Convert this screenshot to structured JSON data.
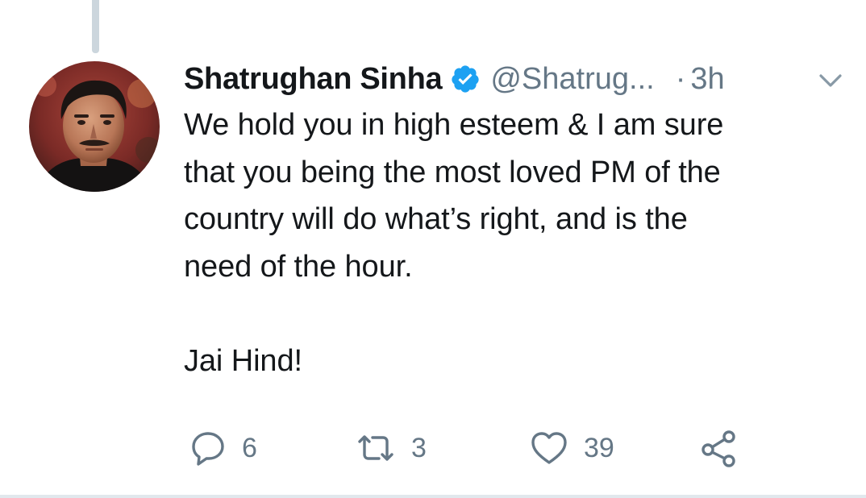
{
  "tweet": {
    "author": {
      "display_name": "Shatrughan Sinha",
      "handle": "@Shatrug...",
      "verified": true,
      "avatar_icon": "profile-photo"
    },
    "separator": "·",
    "time": "3h",
    "menu_icon": "chevron-down-icon",
    "text": "We hold you in high esteem & I am sure\nthat you being the most loved PM of the\ncountry will do what’s right, and is the\nneed of the hour.\n\nJai Hind!",
    "actions": {
      "reply": {
        "icon": "reply-icon",
        "count": "6"
      },
      "retweet": {
        "icon": "retweet-icon",
        "count": "3"
      },
      "like": {
        "icon": "heart-icon",
        "count": "39"
      },
      "share": {
        "icon": "share-icon"
      }
    }
  },
  "colors": {
    "text": "#14171a",
    "secondary": "#657786",
    "verified_blue": "#1da1f2",
    "thread_line": "#ccd6dd"
  }
}
